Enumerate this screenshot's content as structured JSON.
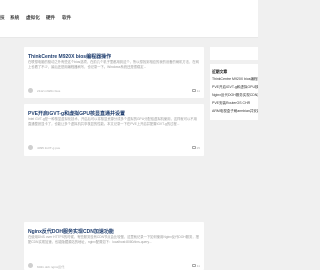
{
  "nav": {
    "items": [
      "技",
      "系统",
      "虚拟化",
      "硬件",
      "软件"
    ]
  },
  "posts": [
    {
      "title": "ThinkCentre M920X bios编程器操作",
      "excerpt": "在联想电脑的驱动之外有些这个bios选项，在前几个机子里都用到这个，所以想找到相应的我的设备的刷机方法，在网上也看了不少，最后还是用编程器刷写，也记录一下。Windows系统还是很稳定...",
      "meta": "2112  m920x bios",
      "comments": "11"
    },
    {
      "title": "PVE开启iGVT-g和虚拟GPU核显直通并设置",
      "excerpt": "Intel GVT-g是一种核显虚拟化技术，开启后可以将核显资源分成多个虚拟的GPU分配给虚拟机使用，这样就可以不用直通整张显卡了，也能让多个虚拟机共享核显的性能。本文记录一下在PVE上开启并配置iGVT-g的过程...",
      "meta": "4095  iGVT-g  pve",
      "comments": "15"
    },
    {
      "title": "Nginx反代DOH服务实现CDN加速功能",
      "excerpt": "在使用DNS over HTTPS的时候，有些服务没有CDN节点会比较慢，这里就记录一下如何使用Nginx反代DOH服务，搭配CDN实现加速，也能隐藏源站的地址，nginx配置如下：localhost:8080/dns-query...",
      "meta": "6021  doh  nginx反代",
      "comments": "11"
    }
  ],
  "sidebar": {
    "title": "近期文章",
    "links": [
      "ThinkCentre M920X bios编程器操作",
      "PVE开启iGVT-g和虚拟GPU核显直通并设置",
      "Nginx反代DOH服务实现CDN加速功能",
      "PVE安装RouterOS CHR",
      "ARM电视盒子刷armbian并安装软件"
    ]
  }
}
